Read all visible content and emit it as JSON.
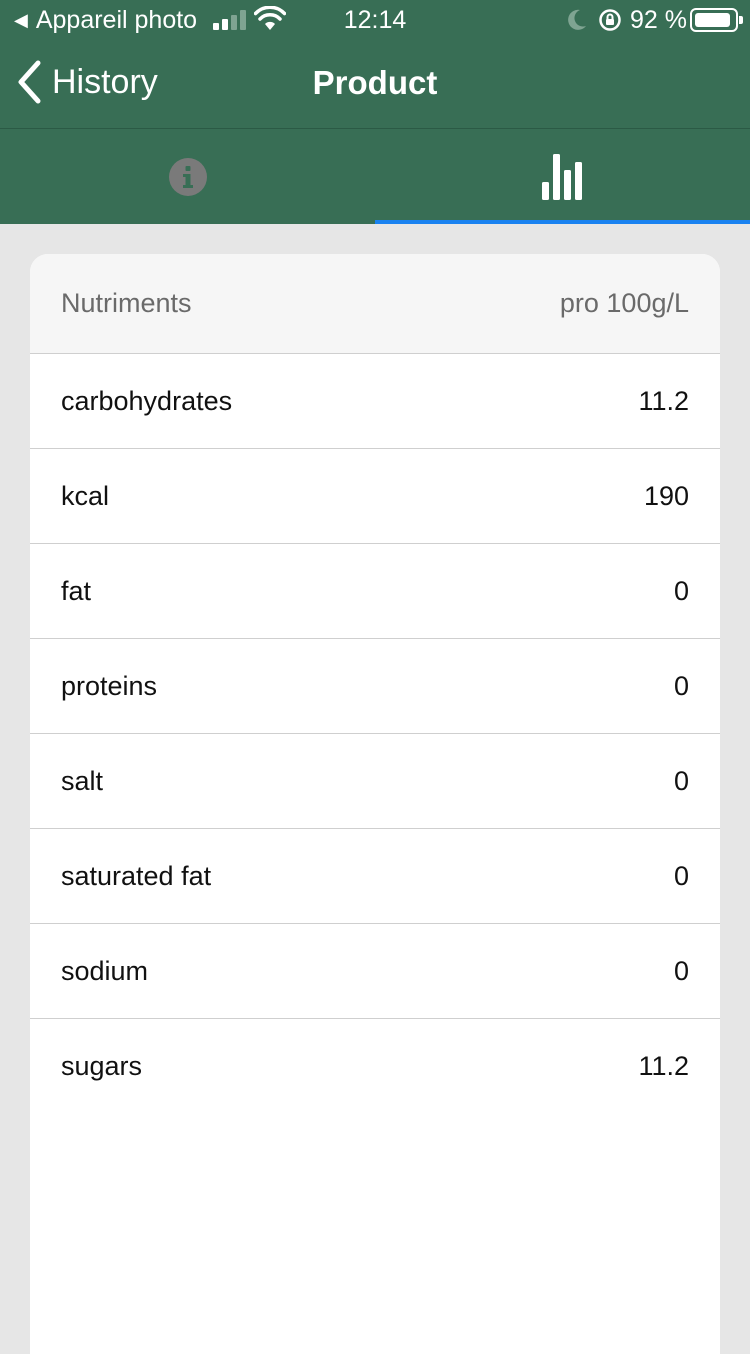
{
  "status_bar": {
    "back_app_label": "Appareil photo",
    "time": "12:14",
    "battery_percent": "92 %",
    "battery_level": 0.92
  },
  "nav": {
    "back_label": "History",
    "title": "Product"
  },
  "tabs": [
    {
      "icon": "info-icon",
      "selected": false
    },
    {
      "icon": "bar-chart-icon",
      "selected": true
    }
  ],
  "colors": {
    "header_green": "#386e55",
    "tab_indicator": "#1a82f0"
  },
  "table": {
    "header_left": "Nutriments",
    "header_right": "pro 100g/L",
    "rows": [
      {
        "name": "carbohydrates",
        "value": "11.2"
      },
      {
        "name": "kcal",
        "value": "190"
      },
      {
        "name": "fat",
        "value": "0"
      },
      {
        "name": "proteins",
        "value": "0"
      },
      {
        "name": "salt",
        "value": "0"
      },
      {
        "name": "saturated fat",
        "value": "0"
      },
      {
        "name": "sodium",
        "value": "0"
      },
      {
        "name": "sugars",
        "value": "11.2"
      }
    ]
  }
}
